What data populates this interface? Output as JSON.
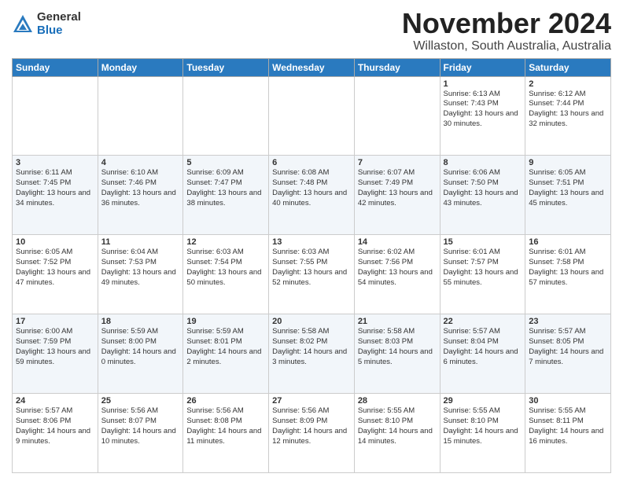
{
  "logo": {
    "general": "General",
    "blue": "Blue"
  },
  "header": {
    "month": "November 2024",
    "location": "Willaston, South Australia, Australia"
  },
  "days_of_week": [
    "Sunday",
    "Monday",
    "Tuesday",
    "Wednesday",
    "Thursday",
    "Friday",
    "Saturday"
  ],
  "weeks": [
    [
      {
        "day": "",
        "info": ""
      },
      {
        "day": "",
        "info": ""
      },
      {
        "day": "",
        "info": ""
      },
      {
        "day": "",
        "info": ""
      },
      {
        "day": "",
        "info": ""
      },
      {
        "day": "1",
        "info": "Sunrise: 6:13 AM\nSunset: 7:43 PM\nDaylight: 13 hours\nand 30 minutes."
      },
      {
        "day": "2",
        "info": "Sunrise: 6:12 AM\nSunset: 7:44 PM\nDaylight: 13 hours\nand 32 minutes."
      }
    ],
    [
      {
        "day": "3",
        "info": "Sunrise: 6:11 AM\nSunset: 7:45 PM\nDaylight: 13 hours\nand 34 minutes."
      },
      {
        "day": "4",
        "info": "Sunrise: 6:10 AM\nSunset: 7:46 PM\nDaylight: 13 hours\nand 36 minutes."
      },
      {
        "day": "5",
        "info": "Sunrise: 6:09 AM\nSunset: 7:47 PM\nDaylight: 13 hours\nand 38 minutes."
      },
      {
        "day": "6",
        "info": "Sunrise: 6:08 AM\nSunset: 7:48 PM\nDaylight: 13 hours\nand 40 minutes."
      },
      {
        "day": "7",
        "info": "Sunrise: 6:07 AM\nSunset: 7:49 PM\nDaylight: 13 hours\nand 42 minutes."
      },
      {
        "day": "8",
        "info": "Sunrise: 6:06 AM\nSunset: 7:50 PM\nDaylight: 13 hours\nand 43 minutes."
      },
      {
        "day": "9",
        "info": "Sunrise: 6:05 AM\nSunset: 7:51 PM\nDaylight: 13 hours\nand 45 minutes."
      }
    ],
    [
      {
        "day": "10",
        "info": "Sunrise: 6:05 AM\nSunset: 7:52 PM\nDaylight: 13 hours\nand 47 minutes."
      },
      {
        "day": "11",
        "info": "Sunrise: 6:04 AM\nSunset: 7:53 PM\nDaylight: 13 hours\nand 49 minutes."
      },
      {
        "day": "12",
        "info": "Sunrise: 6:03 AM\nSunset: 7:54 PM\nDaylight: 13 hours\nand 50 minutes."
      },
      {
        "day": "13",
        "info": "Sunrise: 6:03 AM\nSunset: 7:55 PM\nDaylight: 13 hours\nand 52 minutes."
      },
      {
        "day": "14",
        "info": "Sunrise: 6:02 AM\nSunset: 7:56 PM\nDaylight: 13 hours\nand 54 minutes."
      },
      {
        "day": "15",
        "info": "Sunrise: 6:01 AM\nSunset: 7:57 PM\nDaylight: 13 hours\nand 55 minutes."
      },
      {
        "day": "16",
        "info": "Sunrise: 6:01 AM\nSunset: 7:58 PM\nDaylight: 13 hours\nand 57 minutes."
      }
    ],
    [
      {
        "day": "17",
        "info": "Sunrise: 6:00 AM\nSunset: 7:59 PM\nDaylight: 13 hours\nand 59 minutes."
      },
      {
        "day": "18",
        "info": "Sunrise: 5:59 AM\nSunset: 8:00 PM\nDaylight: 14 hours\nand 0 minutes."
      },
      {
        "day": "19",
        "info": "Sunrise: 5:59 AM\nSunset: 8:01 PM\nDaylight: 14 hours\nand 2 minutes."
      },
      {
        "day": "20",
        "info": "Sunrise: 5:58 AM\nSunset: 8:02 PM\nDaylight: 14 hours\nand 3 minutes."
      },
      {
        "day": "21",
        "info": "Sunrise: 5:58 AM\nSunset: 8:03 PM\nDaylight: 14 hours\nand 5 minutes."
      },
      {
        "day": "22",
        "info": "Sunrise: 5:57 AM\nSunset: 8:04 PM\nDaylight: 14 hours\nand 6 minutes."
      },
      {
        "day": "23",
        "info": "Sunrise: 5:57 AM\nSunset: 8:05 PM\nDaylight: 14 hours\nand 7 minutes."
      }
    ],
    [
      {
        "day": "24",
        "info": "Sunrise: 5:57 AM\nSunset: 8:06 PM\nDaylight: 14 hours\nand 9 minutes."
      },
      {
        "day": "25",
        "info": "Sunrise: 5:56 AM\nSunset: 8:07 PM\nDaylight: 14 hours\nand 10 minutes."
      },
      {
        "day": "26",
        "info": "Sunrise: 5:56 AM\nSunset: 8:08 PM\nDaylight: 14 hours\nand 11 minutes."
      },
      {
        "day": "27",
        "info": "Sunrise: 5:56 AM\nSunset: 8:09 PM\nDaylight: 14 hours\nand 12 minutes."
      },
      {
        "day": "28",
        "info": "Sunrise: 5:55 AM\nSunset: 8:10 PM\nDaylight: 14 hours\nand 14 minutes."
      },
      {
        "day": "29",
        "info": "Sunrise: 5:55 AM\nSunset: 8:10 PM\nDaylight: 14 hours\nand 15 minutes."
      },
      {
        "day": "30",
        "info": "Sunrise: 5:55 AM\nSunset: 8:11 PM\nDaylight: 14 hours\nand 16 minutes."
      }
    ]
  ]
}
